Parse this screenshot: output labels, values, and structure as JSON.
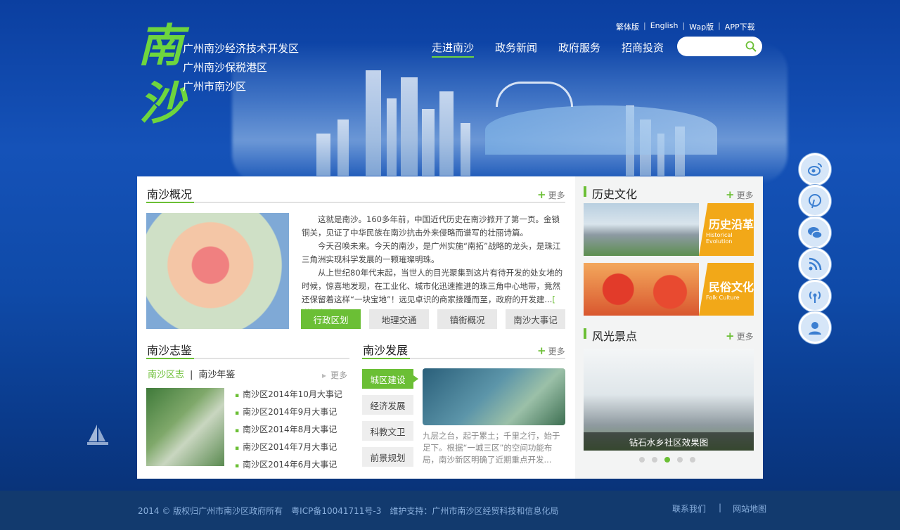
{
  "logo": {
    "chars": [
      "南",
      "沙"
    ]
  },
  "districts": [
    "广州南沙经济技术开发区",
    "广州南沙保税港区",
    "广州市南沙区"
  ],
  "top_links": [
    "繁体版",
    "English",
    "Wap版",
    "APP下载"
  ],
  "main_nav": [
    {
      "label": "走进南沙",
      "active": true
    },
    {
      "label": "政务新闻",
      "active": false
    },
    {
      "label": "政府服务",
      "active": false
    },
    {
      "label": "招商投资",
      "active": false
    }
  ],
  "search": {
    "placeholder": ""
  },
  "side_icons": [
    "weibo-icon",
    "pinterest-icon",
    "wechat-icon",
    "rss-icon",
    "broadcast-icon",
    "service-icon"
  ],
  "overview": {
    "title": "南沙概况",
    "more": "更多",
    "paragraphs": [
      "这就是南沙。160多年前，中国近代历史在南沙掀开了第一页。金锁铜关，见证了中华民族在南沙抗击外来侵略而谱写的壮丽诗篇。",
      "今天召唤未来。今天的南沙，是广州实施“南拓”战略的龙头，是珠江三角洲实现科学发展的一颗璀璨明珠。",
      "从上世纪80年代末起，当世人的目光聚集到这片有待开发的处女地的时候，惊喜地发现，在工业化、城市化迅速推进的珠三角中心地带，竟然还保留着这样“一块宝地”！远见卓识的商家接踵而至，政府的开发建..."
    ],
    "detail_link": "[ 详细点击 ]",
    "tabs": [
      {
        "label": "行政区划",
        "active": true
      },
      {
        "label": "地理交通",
        "active": false
      },
      {
        "label": "镇街概况",
        "active": false
      },
      {
        "label": "南沙大事记",
        "active": false
      }
    ]
  },
  "yearbook": {
    "title": "南沙志鉴",
    "subtabs": [
      {
        "label": "南沙区志",
        "active": true
      },
      {
        "label": "南沙年鉴",
        "active": false
      }
    ],
    "more": "更多",
    "items": [
      "南沙区2014年10月大事记",
      "南沙区2014年9月大事记",
      "南沙区2014年8月大事记",
      "南沙区2014年7月大事记",
      "南沙区2014年6月大事记"
    ]
  },
  "development": {
    "title": "南沙发展",
    "more": "更多",
    "tabs": [
      {
        "label": "城区建设",
        "active": true
      },
      {
        "label": "经济发展",
        "active": false
      },
      {
        "label": "科教文卫",
        "active": false
      },
      {
        "label": "前景规划",
        "active": false
      }
    ],
    "text": "九层之台，起于累土；千里之行，始于足下。根据“一城三区”的空间功能布局，南沙新区明确了近期重点开发..."
  },
  "history": {
    "title": "历史文化",
    "more": "更多",
    "banners": [
      {
        "title": "历史沿革",
        "subtitle": "Historical Evolution"
      },
      {
        "title": "民俗文化",
        "subtitle": "Folk Culture"
      }
    ]
  },
  "scenery": {
    "title": "风光景点",
    "more": "更多",
    "caption": "钻石水乡社区效果图",
    "slide_count": 5,
    "active_slide": 3
  },
  "footer": {
    "copyright": "2014 © 版权归广州市南沙区政府所有　粤ICP备10041711号-3　维护支持：广州市南沙区经贸科技和信息化局",
    "links": [
      "联系我们",
      "网站地图"
    ]
  },
  "colors": {
    "accent": "#6bbf35",
    "background": "#1552b8",
    "footer": "#123a6e",
    "banner": "#f2a818"
  }
}
